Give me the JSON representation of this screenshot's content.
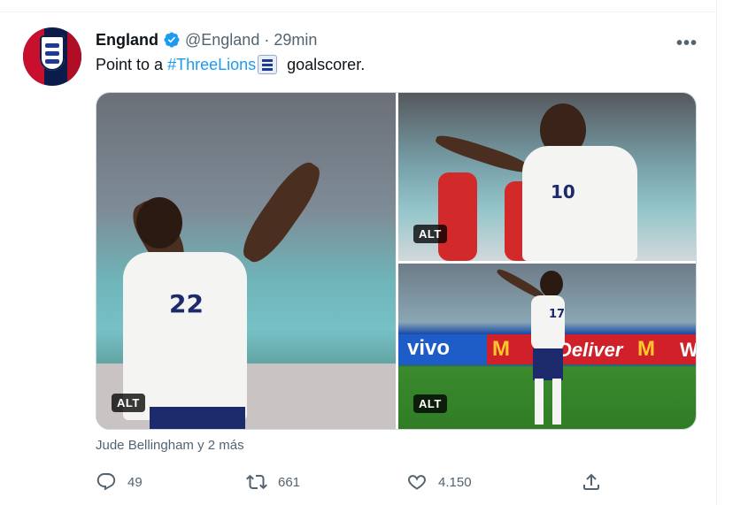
{
  "tweet": {
    "display_name": "England",
    "handle": "@England",
    "separator": "·",
    "time": "29min",
    "more_label": "•••",
    "text_before": "Point to a ",
    "hashtag": "#ThreeLions",
    "text_after": " goalscorer.",
    "verified_icon": "verified-badge-icon",
    "avatar_icon": "england-crest-logo"
  },
  "media": {
    "photos": [
      {
        "alt_label": "ALT",
        "jersey_number": "22"
      },
      {
        "alt_label": "ALT",
        "jersey_number": "10"
      },
      {
        "alt_label": "ALT",
        "jersey_number": "17",
        "boards": [
          "vivo",
          "M",
          "Deliver",
          "M",
          "W"
        ]
      }
    ]
  },
  "tagged_people": "Jude Bellingham y 2 más",
  "actions": {
    "replies": "49",
    "retweets": "661",
    "likes": "4.150",
    "reply_icon": "reply-icon",
    "retweet_icon": "retweet-icon",
    "like_icon": "heart-icon",
    "share_icon": "share-icon"
  },
  "colors": {
    "accent": "#1d9bf0",
    "secondary_text": "#536471",
    "primary_text": "#0f1419",
    "border": "#cfd9de"
  }
}
